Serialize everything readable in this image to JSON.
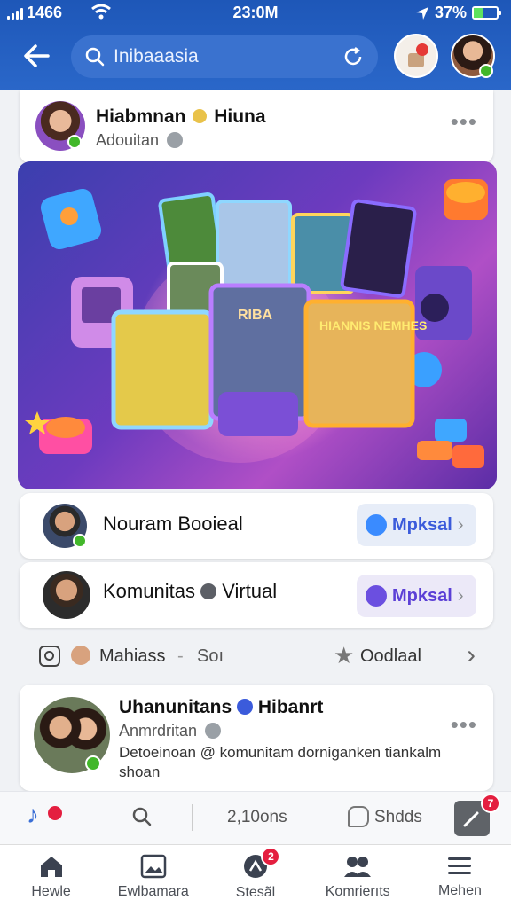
{
  "status_bar": {
    "carrier": "1466",
    "time": "23:0M",
    "battery": "37%",
    "battery_level": 0.37
  },
  "header": {
    "search_text": "Inibaaasia"
  },
  "post1": {
    "name": "Hiabmnan",
    "name2": "Hiuna",
    "subtitle": "Adouitan"
  },
  "hero": {
    "card_text": "RIBA",
    "poster_text": "HIANNIS NEMHES"
  },
  "row1": {
    "name": "Nouram Booieal",
    "button": "Mpksal"
  },
  "row2": {
    "name": "Komunitas",
    "name2": "Virtual",
    "button": "Mpksal"
  },
  "action_row": {
    "left": "Mahiass",
    "middle": "Soı",
    "right": "Oodlaal"
  },
  "post2": {
    "name": "Uhanunitans",
    "name2": "Hibanrt",
    "subtitle": "Anmrdritan",
    "text": "Detoeinoan @ komunitam dorniganken tiankalm shoan"
  },
  "composer": {
    "count": "2,10ons",
    "shares": "Shdds",
    "badge": "7"
  },
  "bottom_nav": [
    {
      "label": "Hewle",
      "icon": "home-icon"
    },
    {
      "label": "Ewlbamara",
      "icon": "image-icon"
    },
    {
      "label": "Stesãl",
      "icon": "social-icon",
      "badge": "2"
    },
    {
      "label": "Komrierıts",
      "icon": "community-icon"
    },
    {
      "label": "Mehen",
      "icon": "menu-icon"
    }
  ],
  "colors": {
    "header": "#1e57b8",
    "accent": "#3b5bdb",
    "online": "#42b72a",
    "badge": "#e41e3f"
  }
}
